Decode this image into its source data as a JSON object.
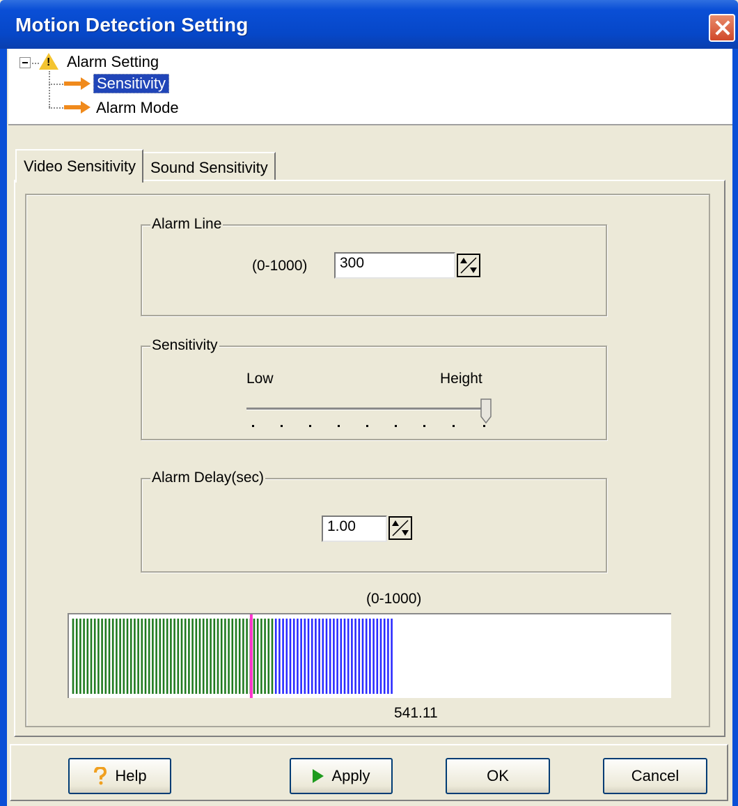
{
  "window": {
    "title": "Motion Detection Setting"
  },
  "tree": {
    "root": "Alarm Setting",
    "children": [
      {
        "label": "Sensitivity",
        "selected": true
      },
      {
        "label": "Alarm Mode",
        "selected": false
      }
    ]
  },
  "tabs": [
    {
      "label": "Video Sensitivity",
      "active": true
    },
    {
      "label": "Sound Sensitivity",
      "active": false
    }
  ],
  "alarm_line": {
    "caption": "Alarm Line",
    "range_label": "(0-1000)",
    "value": "300"
  },
  "sensitivity": {
    "caption": "Sensitivity",
    "low_label": "Low",
    "high_label": "Height",
    "level_fraction": 1.0
  },
  "alarm_delay": {
    "caption": "Alarm Delay(sec)",
    "value": "1.00"
  },
  "meter": {
    "range_label": "(0-1000)",
    "value_label": "541.11",
    "alarm_line_fraction": 0.3,
    "green_fraction": 0.337,
    "blue_fraction": 0.541,
    "colors": {
      "green": "#1f7a1f",
      "blue": "#2a2aff",
      "marker": "#ff33cc"
    }
  },
  "buttons": {
    "help": "Help",
    "apply": "Apply",
    "ok": "OK",
    "cancel": "Cancel"
  }
}
